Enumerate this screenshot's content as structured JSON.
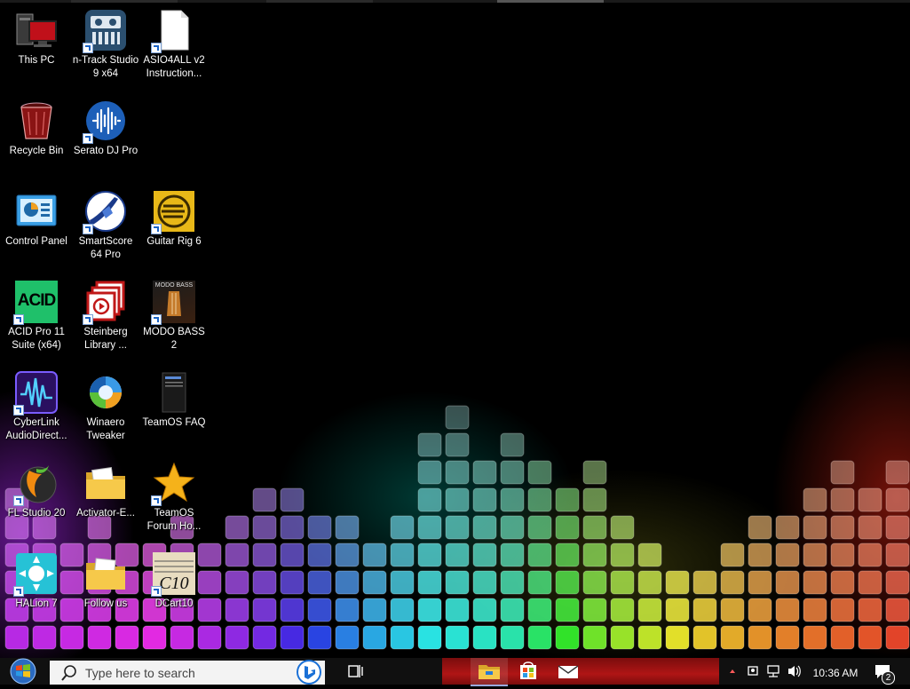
{
  "desktop": {
    "icons": [
      {
        "id": "this-pc",
        "label": "This PC"
      },
      {
        "id": "n-track",
        "label": "n-Track Studio 9 x64"
      },
      {
        "id": "asio4all",
        "label": "ASIO4ALL v2 Instruction..."
      },
      {
        "id": "recycle-bin",
        "label": "Recycle Bin"
      },
      {
        "id": "serato",
        "label": "Serato DJ Pro"
      },
      {
        "id": "control-panel",
        "label": "Control Panel"
      },
      {
        "id": "smartscore",
        "label": "SmartScore 64 Pro"
      },
      {
        "id": "guitar-rig",
        "label": "Guitar Rig 6"
      },
      {
        "id": "acid-pro",
        "label": "ACID Pro 11 Suite (x64)"
      },
      {
        "id": "steinberg",
        "label": "Steinberg Library ..."
      },
      {
        "id": "modo-bass",
        "label": "MODO BASS 2"
      },
      {
        "id": "cyberlink",
        "label": "CyberLink AudioDirect..."
      },
      {
        "id": "winaero",
        "label": "Winaero Tweaker"
      },
      {
        "id": "teamos-faq",
        "label": "TeamOS FAQ"
      },
      {
        "id": "fl-studio",
        "label": "FL Studio 20"
      },
      {
        "id": "activator",
        "label": "Activator-E..."
      },
      {
        "id": "teamos-forum",
        "label": "TeamOS Forum Ho..."
      },
      {
        "id": "halion",
        "label": "HALion 7"
      },
      {
        "id": "follow-us",
        "label": "Follow us"
      },
      {
        "id": "dcart",
        "label": "DCart10"
      }
    ],
    "icon_texts": {
      "acid": "ACID",
      "modo": "MODO BASS",
      "dcart": "C10"
    }
  },
  "taskbar": {
    "search_placeholder": "Type here to search",
    "clock": "10:36 AM",
    "notification_count": "2"
  }
}
